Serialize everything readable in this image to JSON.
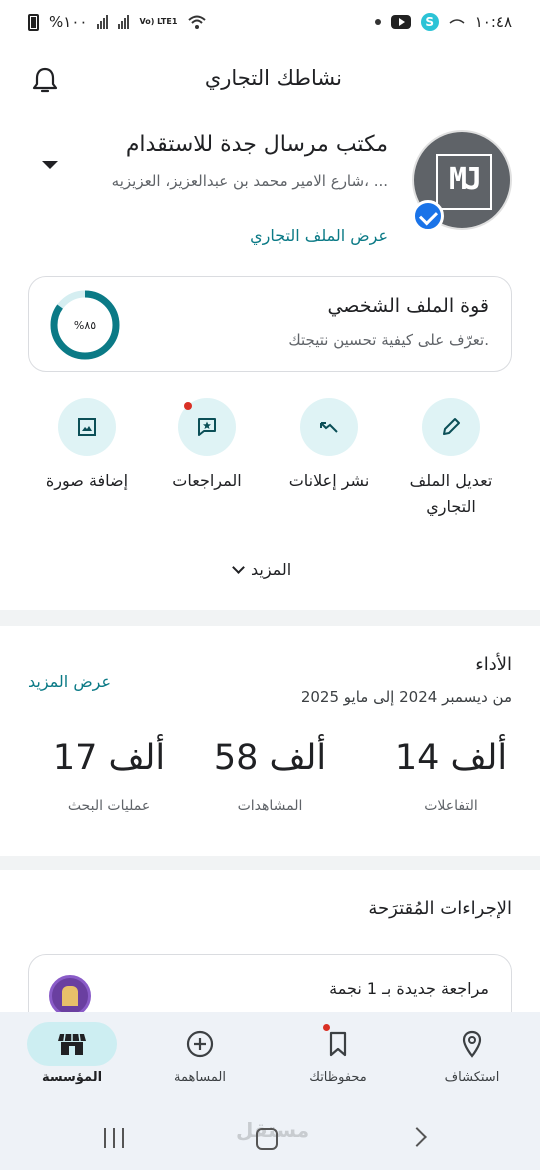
{
  "status_bar": {
    "time": "١٠:٤٨",
    "battery": "%١٠٠",
    "network": "Vo) LTE1"
  },
  "header": {
    "title": "نشاطك التجاري"
  },
  "business": {
    "name": "مكتب مرسال جدة للاستقدام",
    "address": "شارع الامير محمد بن عبدالعزيز، العزيزيه، ...",
    "logo_text": "MJ",
    "view_profile": "عرض الملف التجاري"
  },
  "strength": {
    "title": "قوة الملف الشخصي",
    "subtitle": "تعرّف على كيفية تحسين نتيجتك.",
    "percent_label": "%٨٥",
    "percent": 85
  },
  "actions": [
    {
      "label": "تعديل الملف التجاري",
      "icon": "pencil-icon"
    },
    {
      "label": "نشر إعلانات",
      "icon": "trend-icon"
    },
    {
      "label": "المراجعات",
      "icon": "review-star-icon"
    },
    {
      "label": "إضافة صورة",
      "icon": "image-icon"
    }
  ],
  "more_label": "المزيد",
  "performance": {
    "title": "الأداء",
    "range": "من ديسمبر 2024 إلى مايو 2025",
    "view_more": "عرض المزيد",
    "stats": [
      {
        "value": "14 ألف",
        "label": "التفاعلات"
      },
      {
        "value": "58 ألف",
        "label": "المشاهدات"
      },
      {
        "value": "17 ألف",
        "label": "عمليات البحث"
      }
    ]
  },
  "suggestions": {
    "title": "الإجراءات المُقترَحة",
    "review_text": "مراجعة جديدة بـ 1 نجمة"
  },
  "bottom_nav": [
    {
      "label": "استكشاف",
      "icon": "location-pin-icon"
    },
    {
      "label": "محفوظاتك",
      "icon": "bookmark-icon"
    },
    {
      "label": "المساهمة",
      "icon": "add-circle-icon"
    },
    {
      "label": "المؤسسة",
      "icon": "storefront-icon"
    }
  ],
  "watermark": "مستقل",
  "colors": {
    "accent": "#0b7a86",
    "action_bg": "#dff3f5",
    "nav_active": "#cdeef2",
    "verified": "#1a73e8",
    "alert": "#d93025"
  }
}
